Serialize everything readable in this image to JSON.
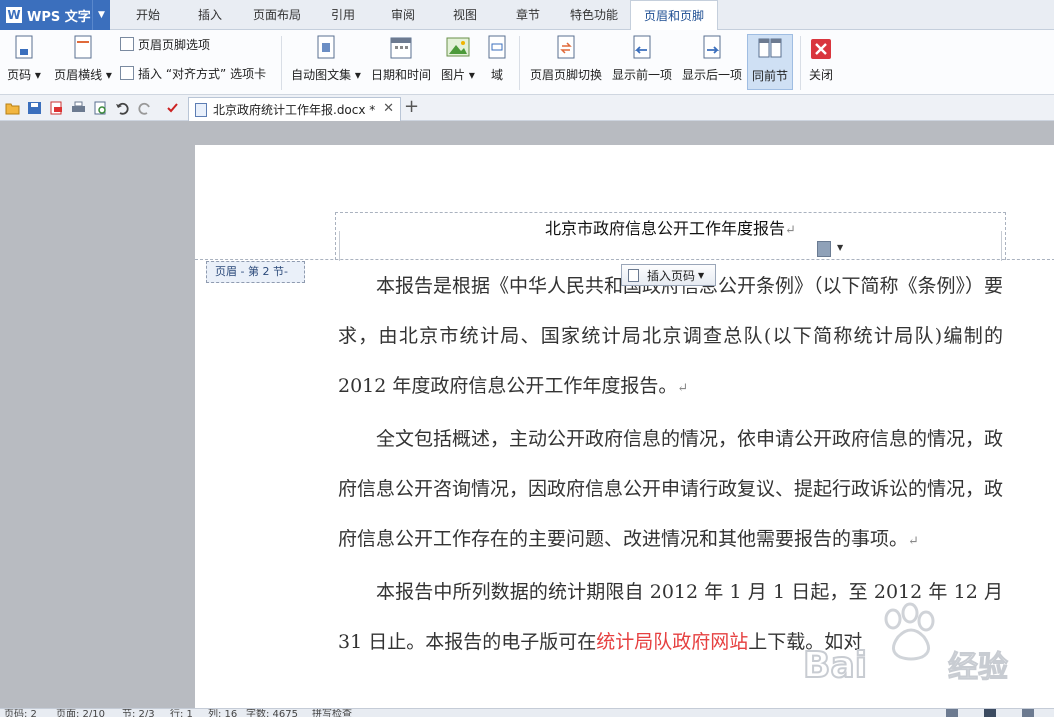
{
  "app": {
    "name": "WPS 文字"
  },
  "ribbon_tabs": [
    "开始",
    "插入",
    "页面布局",
    "引用",
    "审阅",
    "视图",
    "章节",
    "特色功能",
    "页眉和页脚"
  ],
  "ribbon": {
    "page_number": "页码",
    "header_line": "页眉横线",
    "header_footer_options": "页眉页脚选项",
    "insert_align_tab": "插入 “对齐方式” 选项卡",
    "auto_text": "自动图文集",
    "date_time": "日期和时间",
    "picture": "图片",
    "field": "域",
    "switch_header_footer": "页眉页脚切换",
    "show_previous": "显示前一项",
    "show_next": "显示后一项",
    "same_as_previous": "同前节",
    "close": "关闭"
  },
  "document_tab": {
    "filename": "北京政府统计工作年报.docx *"
  },
  "page": {
    "header_text": "北京市政府信息公开工作年度报告",
    "section_label": "页眉 - 第 2 节-",
    "insert_page_number": "插入页码",
    "paragraphs": [
      "本报告是根据《中华人民共和国政府信息公开条例》（以下简称《条例》）要求，由北京市统计局、国家统计局北京调查总队(以下简称统计局队)编制的 2012 年度政府信息公开工作年度报告。",
      "全文包括概述，主动公开政府信息的情况，依申请公开政府信息的情况，政府信息公开咨询情况，因政府信息公开申请行政复议、提起行政诉讼的情况，政府信息公开工作存在的主要问题、改进情况和其他需要报告的事项。"
    ],
    "p3_before": "本报告中所列数据的统计期限自 2012 年 1 月 1 日起，至 2012 年 12 月 31 日止。本报告的电子版可在",
    "p3_link": "统计局队政府网站",
    "p3_after": "上下载。如对",
    "paragraph_mark": "↵"
  },
  "watermark": {
    "text": "Bai 经验"
  },
  "statusbar": {
    "page_num": "页码: 2",
    "pages": "页面: 2/10",
    "section": "节: 2/3",
    "row": "行: 1",
    "col": "列: 16",
    "char_count": "字数: 4675",
    "spell_check": "拼写检查"
  },
  "colors": {
    "accent": "#3b6fbd",
    "link": "#e64040",
    "active_tab_text": "#1f4f93"
  }
}
